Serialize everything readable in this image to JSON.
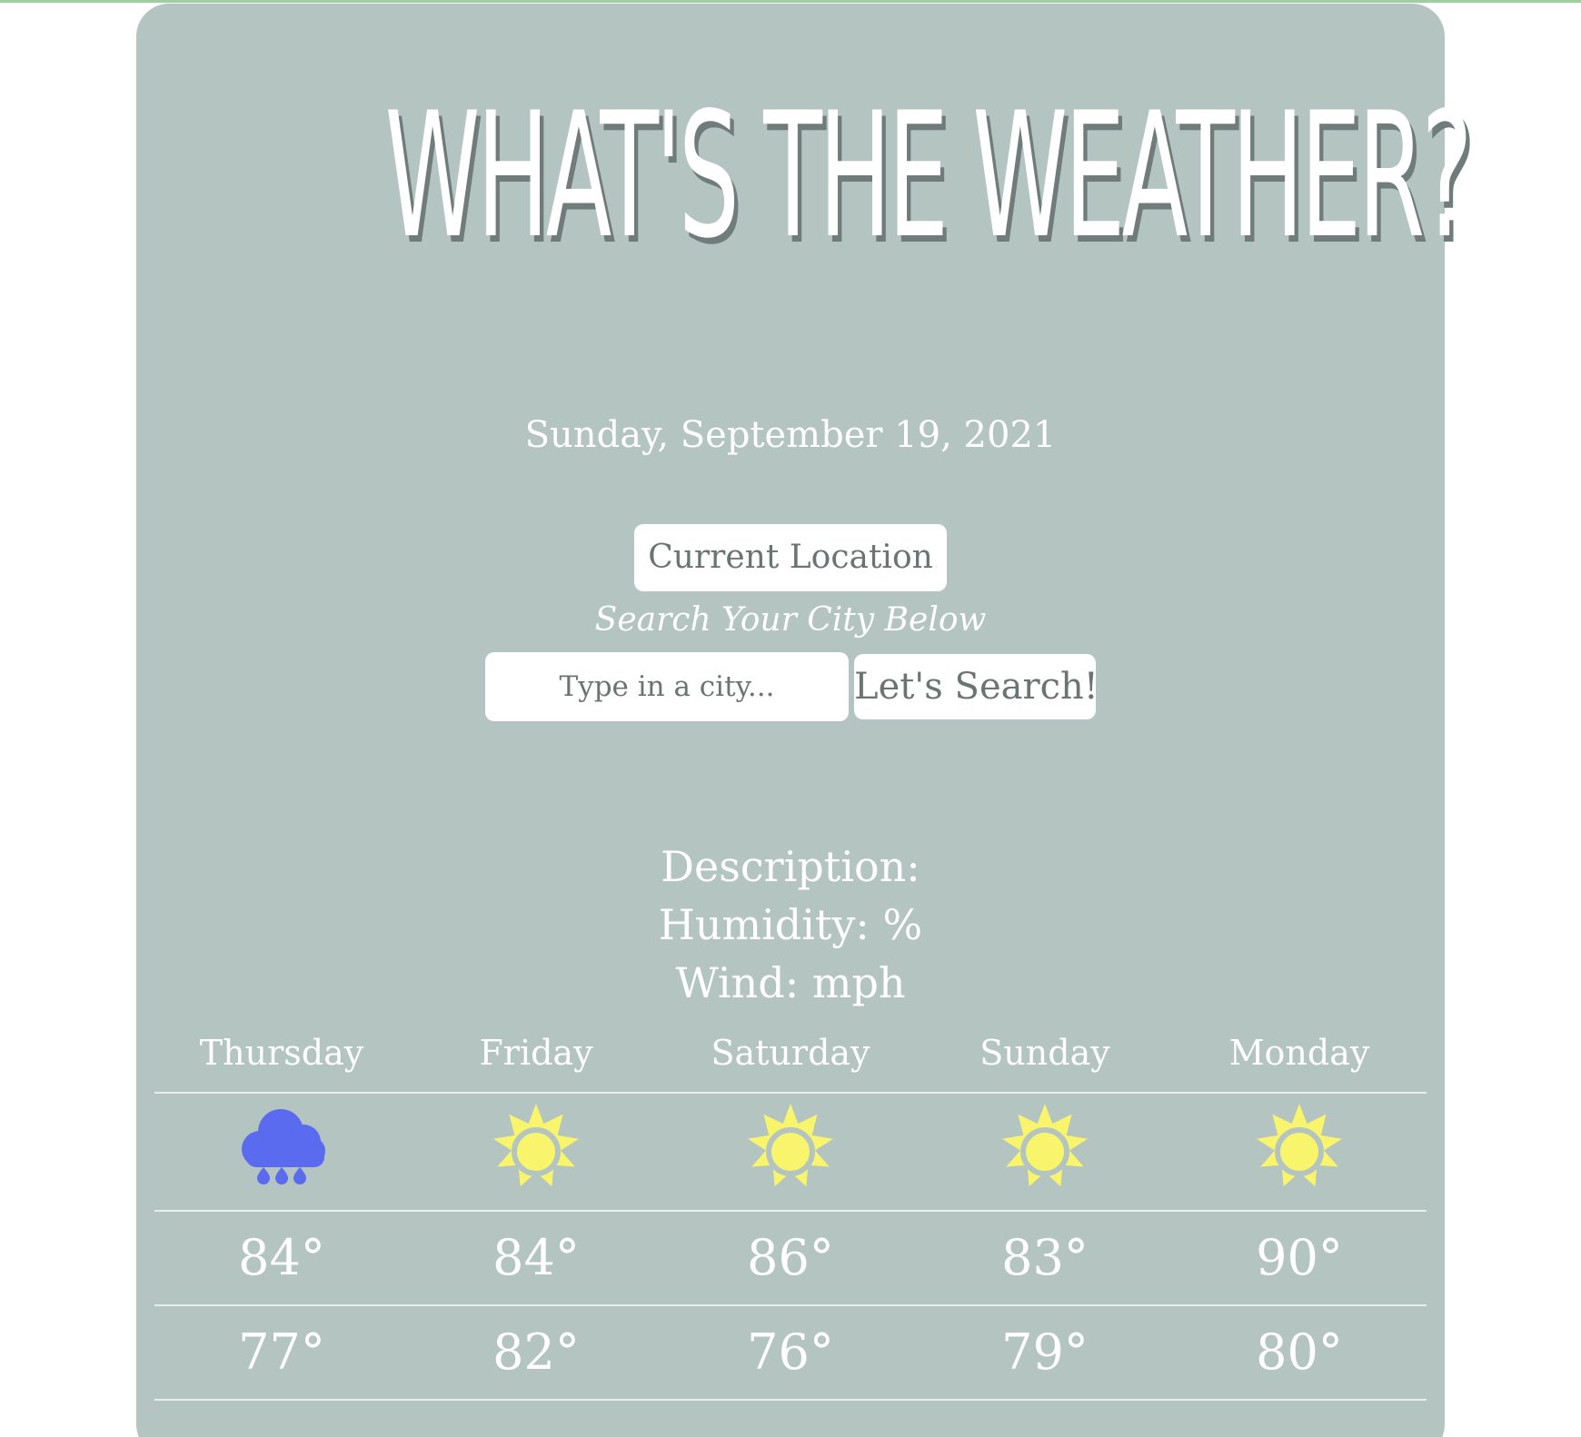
{
  "header": {
    "title": "WHAT'S THE WEATHER?",
    "date": "Sunday, September 19, 2021"
  },
  "controls": {
    "current_location_label": "Current Location",
    "search_hint": "Search Your City Below",
    "city_input_placeholder": "Type in a city...",
    "city_input_value": "",
    "search_label": "Let's Search!"
  },
  "current": {
    "description_line": "Description:",
    "humidity_line": "Humidity: %",
    "wind_line": "Wind: mph"
  },
  "forecast": [
    {
      "day": "Thursday",
      "icon": "rain-cloud-icon",
      "high": "84°",
      "low": "77°"
    },
    {
      "day": "Friday",
      "icon": "sun-icon",
      "high": "84°",
      "low": "82°"
    },
    {
      "day": "Saturday",
      "icon": "sun-icon",
      "high": "86°",
      "low": "76°"
    },
    {
      "day": "Sunday",
      "icon": "sun-icon",
      "high": "83°",
      "low": "79°"
    },
    {
      "day": "Monday",
      "icon": "sun-icon",
      "high": "90°",
      "low": "80°"
    }
  ],
  "colors": {
    "card_background": "#b3c4c1",
    "title_shadow": "#6f7c79",
    "button_text": "#6a7472",
    "sun_fill": "#f8f46c",
    "rain_cloud": "#5a6bef",
    "top_border": "#9fcfa0"
  }
}
